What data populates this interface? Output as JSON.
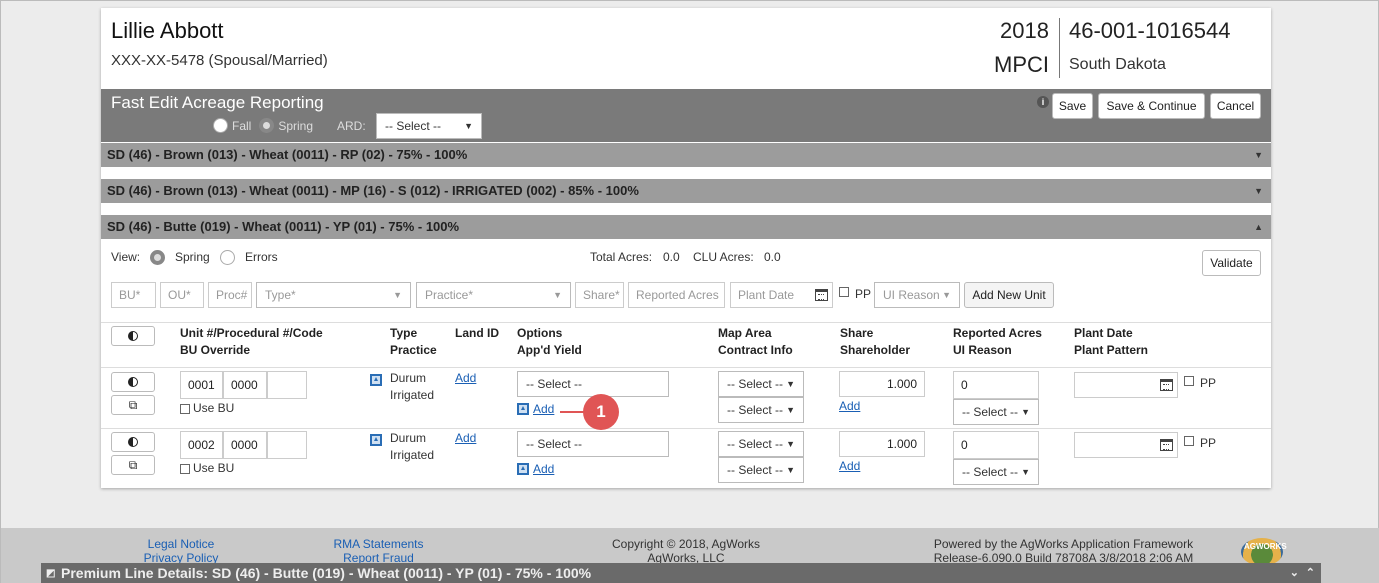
{
  "header": {
    "name": "Lillie Abbott",
    "ssn": "XXX-XX-5478 (Spousal/Married)",
    "year": "2018",
    "program": "MPCI",
    "policy": "46-001-1016544",
    "state": "South Dakota"
  },
  "fast_edit": {
    "title": "Fast Edit Acreage Reporting",
    "fall_label": "Fall",
    "spring_label": "Spring",
    "ard_label": "ARD:",
    "ard_select": "-- Select --",
    "save": "Save",
    "save_continue": "Save & Continue",
    "cancel": "Cancel",
    "info_icon": "i"
  },
  "sections": [
    {
      "label": "SD (46) - Brown (013) - Wheat (0011) - RP (02) - 75% - 100%",
      "caret": "▼"
    },
    {
      "label": "SD (46) - Brown (013) - Wheat (0011) - MP (16) - S (012) - IRRIGATED (002) - 85% - 100%",
      "caret": "▼"
    },
    {
      "label": "SD (46) - Butte (019) - Wheat (0011) - YP (01) - 75% - 100%",
      "caret": "▲"
    }
  ],
  "view": {
    "label": "View:",
    "spring": "Spring",
    "errors": "Errors",
    "total_acres_label": "Total Acres:",
    "total_acres": "0.0",
    "clu_acres_label": "CLU Acres:",
    "clu_acres": "0.0",
    "validate": "Validate"
  },
  "new_unit": {
    "bu": "BU*",
    "ou": "OU*",
    "proc": "Proc#",
    "type": "Type*",
    "practice": "Practice*",
    "share": "Share*",
    "reported": "Reported Acres",
    "plant_date": "Plant Date",
    "pp": "PP",
    "ui_reason": "UI Reason",
    "add_btn": "Add New Unit"
  },
  "columns": {
    "unit": "Unit #/Procedural #/Code",
    "bu_override": "BU Override",
    "type": "Type",
    "practice": "Practice",
    "land_id": "Land ID",
    "options": "Options",
    "appd_yield": "App'd Yield",
    "map_area": "Map Area",
    "contract_info": "Contract Info",
    "share": "Share",
    "shareholder": "Shareholder",
    "reported_acres": "Reported Acres",
    "ui_reason": "UI Reason",
    "plant_date": "Plant Date",
    "plant_pattern": "Plant Pattern"
  },
  "rows": [
    {
      "unit": "0001",
      "proc": "0000",
      "code": "",
      "use_bu": "Use BU",
      "type": "Durum",
      "practice": "Irrigated",
      "land_add": "Add",
      "options_select": "-- Select --",
      "yield_add": "Add",
      "map_select": "-- Select --",
      "contract_select": "-- Select --",
      "share": "1.000",
      "share_add": "Add",
      "reported": "0",
      "ui_select": "-- Select --",
      "plant_date": "",
      "pp": "PP"
    },
    {
      "unit": "0002",
      "proc": "0000",
      "code": "",
      "use_bu": "Use BU",
      "type": "Durum",
      "practice": "Irrigated",
      "land_add": "Add",
      "options_select": "-- Select --",
      "yield_add": "Add",
      "map_select": "-- Select --",
      "contract_select": "-- Select --",
      "share": "1.000",
      "share_add": "Add",
      "reported": "0",
      "ui_select": "-- Select --",
      "plant_date": "",
      "pp": "PP"
    }
  ],
  "callout": "1",
  "footer": {
    "legal": "Legal Notice",
    "privacy": "Privacy Policy",
    "rma": "RMA Statements",
    "fraud": "Report Fraud",
    "copyright": "Copyright © 2018, AgWorks",
    "company": "AgWorks, LLC",
    "powered": "Powered by the AgWorks Application Framework",
    "release": "Release-6.090.0 Build 78708A 3/8/2018 2:06 AM",
    "logo": "AGWORKS"
  },
  "premium": "Premium Line Details: SD (46) - Butte (019) - Wheat (0011) - YP (01) - 75% - 100%"
}
